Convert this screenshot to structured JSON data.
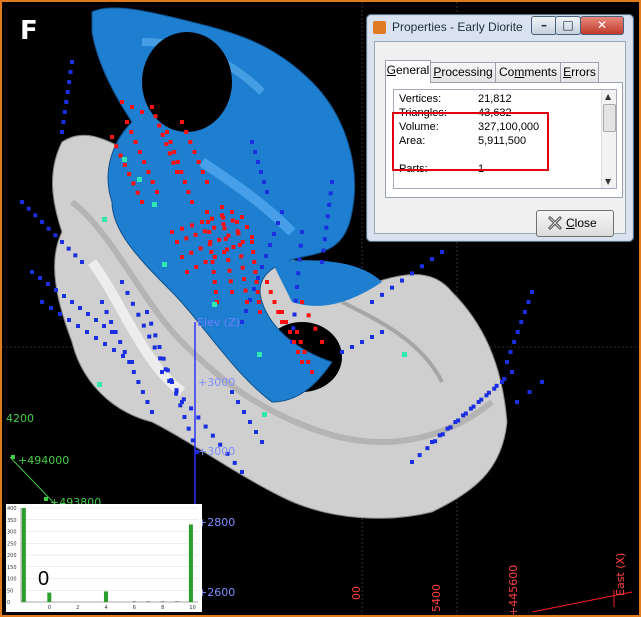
{
  "panel_letter": "F",
  "viewport": {
    "elev_axis_label": "Elev (Z)",
    "elev_ticks": [
      "+3000",
      "+3000",
      "+2800",
      "+2600"
    ],
    "grid_labels_left": [
      "4200",
      "+494000",
      "+493800"
    ],
    "grid_labels_bottom": [
      "00",
      "5400",
      "+445600"
    ],
    "east_axis_label": "East (X)",
    "colors": {
      "surface_blue": "#1e7fd0",
      "surface_white": "#d8d8d8",
      "points_blue": "#1a2fe0",
      "points_red": "#ff1010",
      "grid_red": "#ff2020",
      "grid_green": "#44cc44"
    }
  },
  "dialog": {
    "title": "Properties - Early Diorite",
    "minimize_glyph": "–",
    "maximize_glyph": "□",
    "close_glyph": "✕",
    "tabs": [
      {
        "label": "General",
        "active": true
      },
      {
        "label": "Processing",
        "active": false
      },
      {
        "label": "Comments",
        "active": false
      },
      {
        "label": "Errors",
        "active": false
      }
    ],
    "properties": [
      {
        "label": "Vertices:",
        "value": "21,812"
      },
      {
        "label": "Triangles:",
        "value": "43,632"
      },
      {
        "label": "Volume:",
        "value": "327,100,000"
      },
      {
        "label": "Area:",
        "value": "5,911,500"
      },
      {
        "label": "Parts:",
        "value": "1"
      }
    ],
    "close_button_label": "Close"
  },
  "histogram": {
    "zero_label": "0",
    "y_ticks": [
      "400",
      "350",
      "300",
      "250",
      "200",
      "150",
      "100",
      "50",
      "0"
    ],
    "x_ticks": [
      "0",
      "2",
      "4",
      "6",
      "8",
      "10"
    ],
    "bar_color": "#2a9d2a"
  },
  "chart_data": {
    "type": "bar",
    "x": [
      -1.8,
      0,
      4,
      10
    ],
    "values": [
      400,
      40,
      45,
      330
    ],
    "ylim": [
      0,
      400
    ],
    "xlim": [
      -2,
      10.5
    ]
  }
}
